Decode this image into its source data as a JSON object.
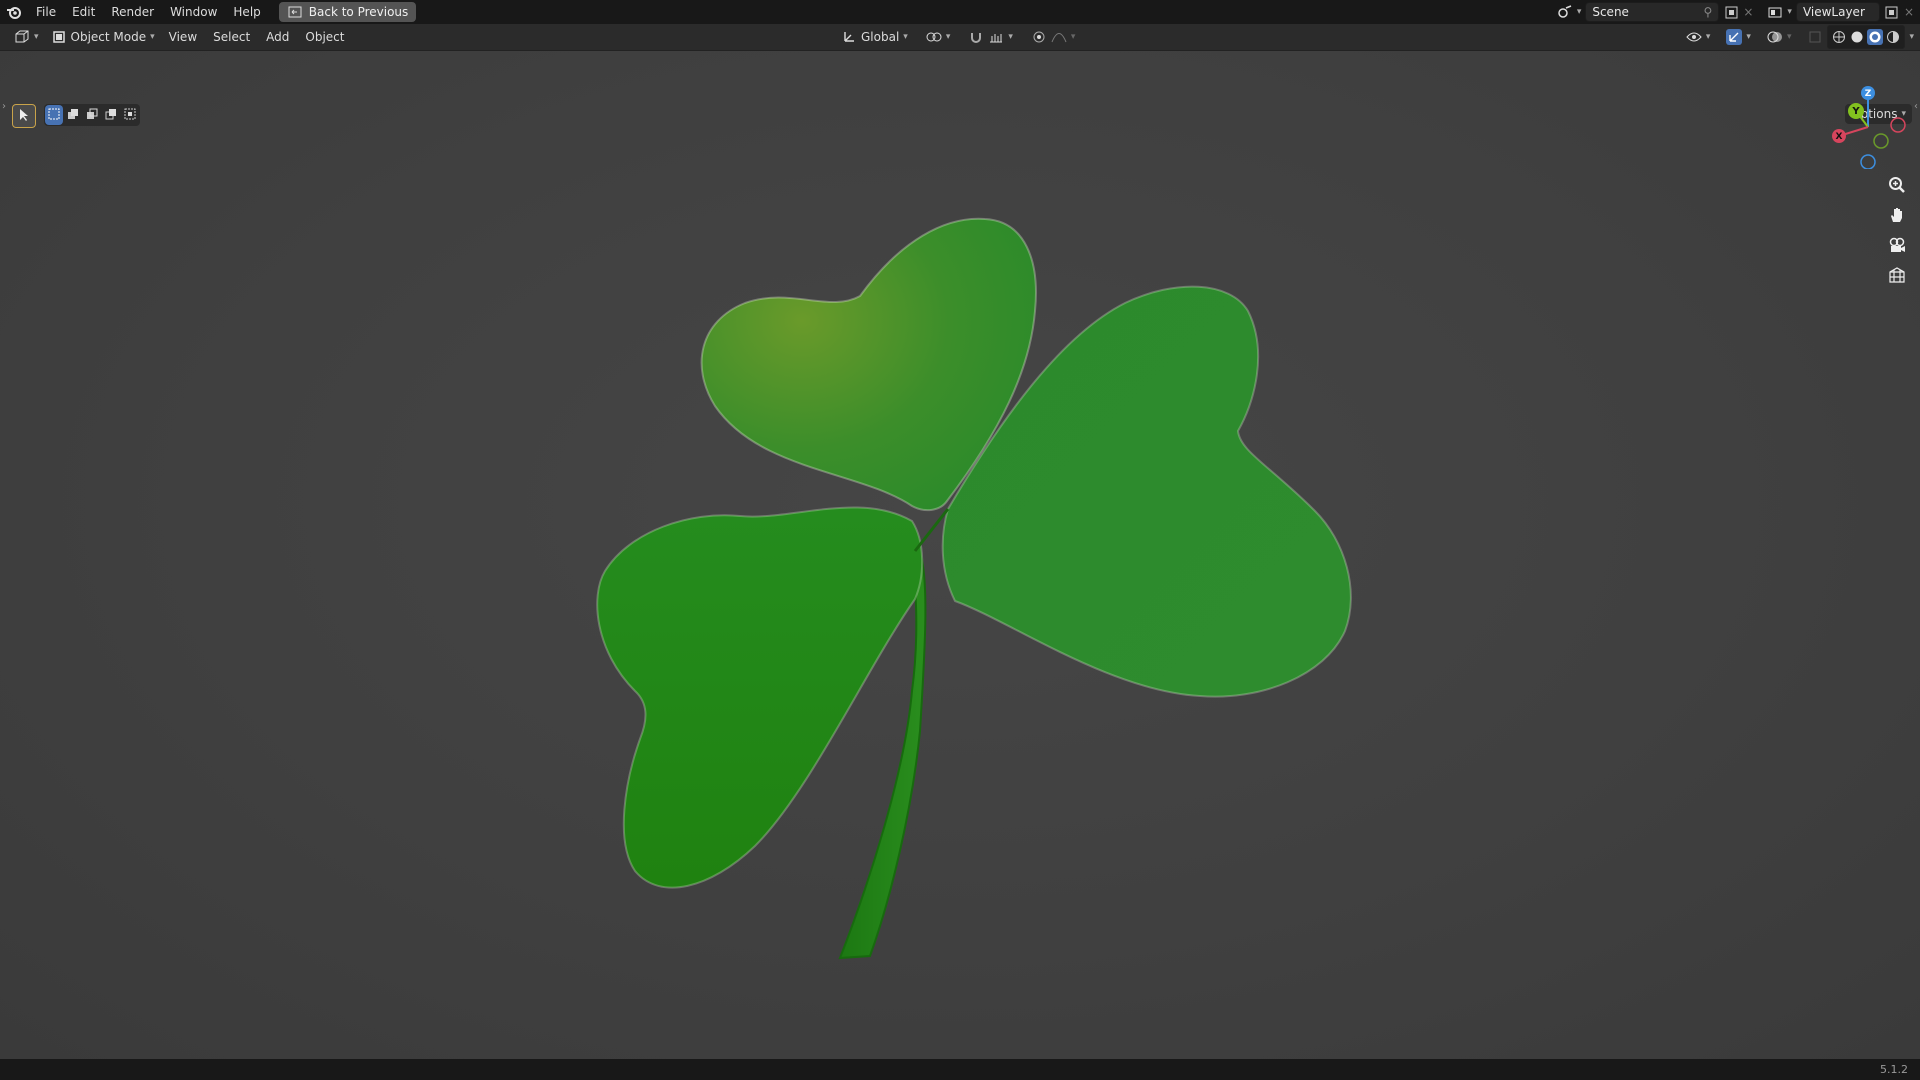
{
  "topbar": {
    "menus": [
      "File",
      "Edit",
      "Render",
      "Window",
      "Help"
    ],
    "back_button": "Back to Previous",
    "scene": "Scene",
    "view_layer": "ViewLayer"
  },
  "header": {
    "mode": "Object Mode",
    "menus": [
      "View",
      "Select",
      "Add",
      "Object"
    ],
    "transform_orientation": "Global",
    "options_label": "Options"
  },
  "gizmo": {
    "x_label": "X",
    "y_label": "Y",
    "z_label": "Z"
  },
  "status": {
    "version": "5.1.2"
  },
  "colors": {
    "leaf_dark": "#1f7d12",
    "leaf_mid": "#2f8a2a",
    "leaf_light": "#6a9a2a",
    "viewport_bg": "#404040",
    "axis_x": "#d6455d",
    "axis_y": "#82c11f",
    "axis_z": "#3d8fe0"
  },
  "icons": {
    "app": "blender-logo-icon",
    "zoom": "zoom-icon",
    "pan": "hand-icon",
    "camera": "camera-icon",
    "ortho": "grid-icon"
  }
}
